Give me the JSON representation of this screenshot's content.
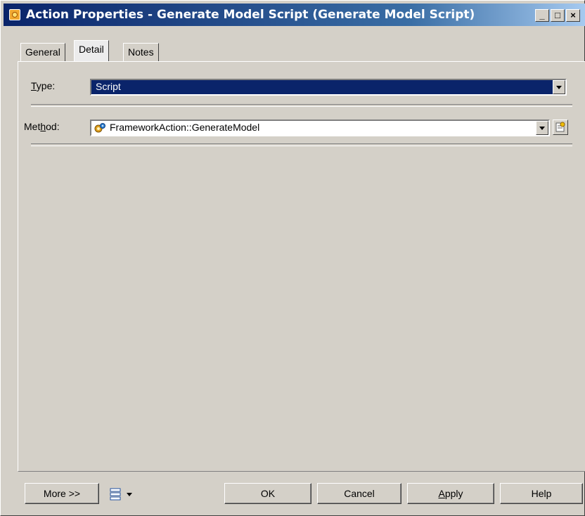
{
  "window": {
    "title": "Action Properties - Generate Model Script (Generate Model Script)",
    "controls": {
      "minimize": "_",
      "maximize": "□",
      "close": "×"
    }
  },
  "tabs": [
    {
      "label": "General",
      "active": false
    },
    {
      "label": "Detail",
      "active": true
    },
    {
      "label": "Notes",
      "active": false
    }
  ],
  "detail": {
    "type_label_prefix": "T",
    "type_label_rest": "ype:",
    "type_value": "Script",
    "method_label_prefix": "Met",
    "method_label_accel": "h",
    "method_label_rest": "od:",
    "method_value": "FrameworkAction::GenerateModel"
  },
  "footer": {
    "more_label": "More >>",
    "ok_label": "OK",
    "cancel_label": "Cancel",
    "apply_label_accel": "A",
    "apply_label_rest": "pply",
    "help_label": "Help"
  },
  "colors": {
    "titlebar_start": "#0a246a",
    "selection": "#0a246a",
    "window_bg": "#d4d0c8"
  },
  "icons": [
    "app-icon",
    "minimize-icon",
    "maximize-icon",
    "close-icon",
    "gear-icon",
    "properties-icon",
    "dropdown-arrow-icon",
    "list-view-icon"
  ]
}
